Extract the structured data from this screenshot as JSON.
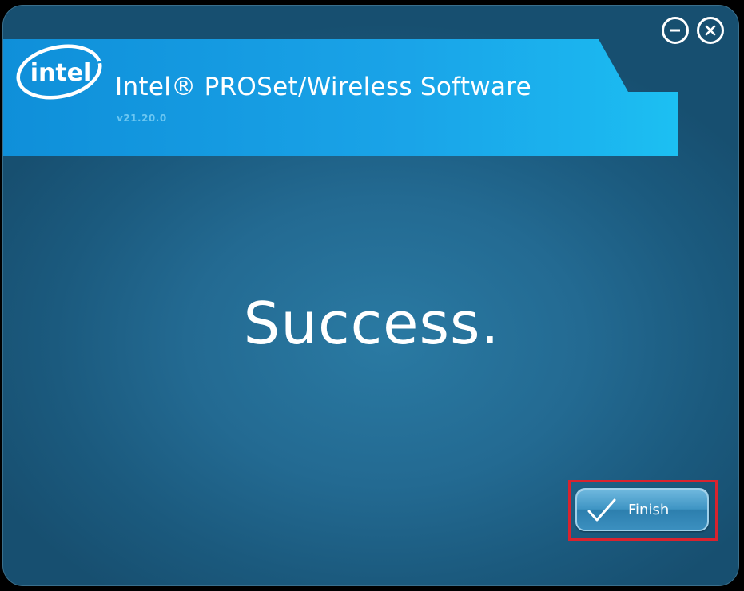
{
  "window": {
    "product_title": "Intel® PROSet/Wireless Software",
    "version": "v21.20.0",
    "logo_text": "intel"
  },
  "controls": {
    "minimize_icon": "minimize-circle-icon",
    "close_icon": "close-circle-icon"
  },
  "main": {
    "message": "Success."
  },
  "footer": {
    "finish_label": "Finish",
    "finish_icon": "checkmark-icon"
  },
  "colors": {
    "banner": "#1aa4e8",
    "background": "#236a92",
    "highlight": "#d9232e"
  }
}
